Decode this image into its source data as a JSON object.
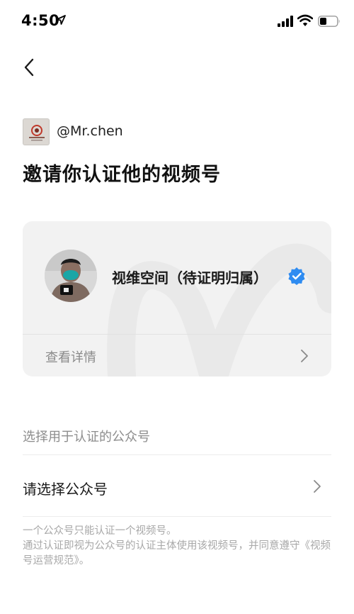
{
  "status_bar": {
    "time": "4:50",
    "icons": [
      "location-arrow-icon",
      "cellular-signal-icon",
      "wifi-icon",
      "battery-icon"
    ]
  },
  "nav": {
    "back_icon": "chevron-left-icon"
  },
  "inviter": {
    "handle": "@Mr.chen"
  },
  "page_title": "邀请你认证他的视频号",
  "channel_card": {
    "name": "视维空间（待证明归属）",
    "verified_icon": "verified-badge-icon",
    "verified_color": "#2f8cf1",
    "view_details_label": "查看详情"
  },
  "select_section": {
    "label": "选择用于认证的公众号",
    "select_label": "请选择公众号"
  },
  "notice": {
    "line1": "一个公众号只能认证一个视频号。",
    "line2": "通过认证即视为公众号的认证主体使用该视频号，并同意遵守《视频号运营规范》。"
  }
}
